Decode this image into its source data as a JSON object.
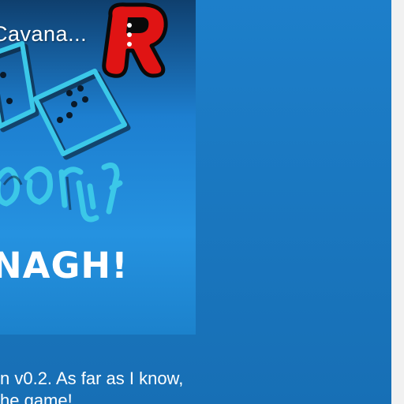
{
  "thumbnail": {
    "title": "Cavana...",
    "game_name": "NAGH!",
    "badge_letter": "R"
  },
  "description": {
    "lines": [
      "n v0.2. As far as I know,",
      "he game!"
    ]
  },
  "colors": {
    "panel_blue": "#1d7fca",
    "dice_cyan": "#3bc8e8",
    "badge_red": "#e01414"
  },
  "icons": [
    "dice-icon",
    "robot-badge-icon"
  ]
}
